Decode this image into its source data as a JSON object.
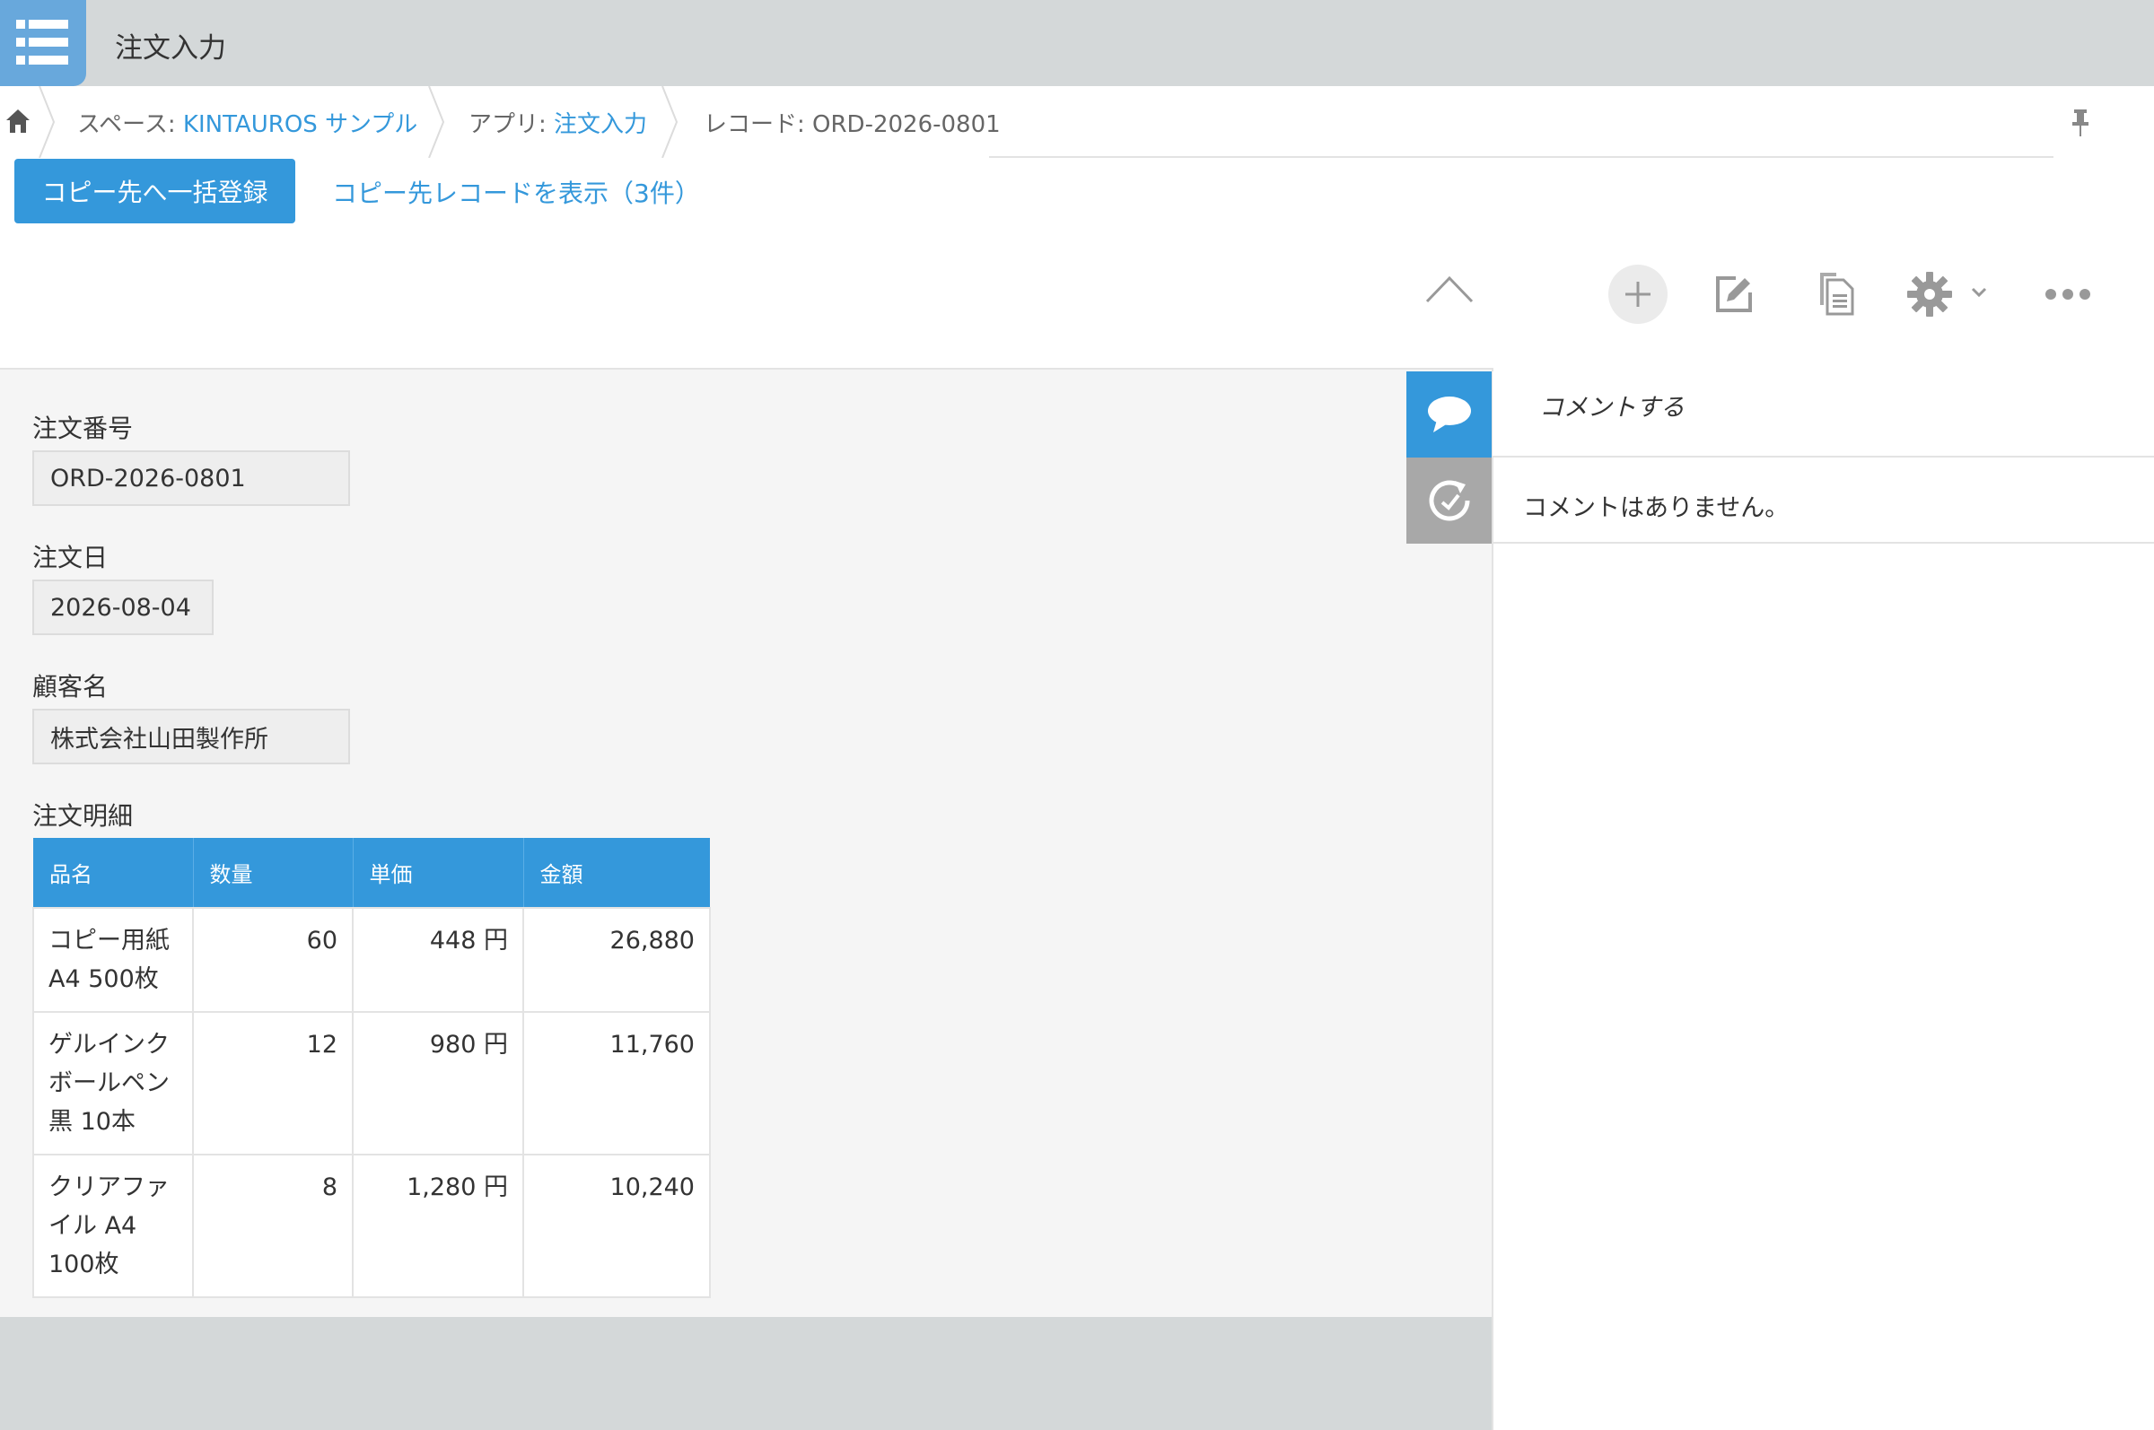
{
  "header": {
    "app_title": "注文入力"
  },
  "breadcrumb": {
    "space_prefix": "スペース: ",
    "space_name": "KINTAUROS サンプル",
    "app_prefix": "アプリ: ",
    "app_name": "注文入力",
    "record_label": "レコード: ORD-2026-0801"
  },
  "actions": {
    "bulk_register": "コピー先へ一括登録",
    "show_copies": "コピー先レコードを表示（3件）"
  },
  "fields": {
    "order_no_label": "注文番号",
    "order_no_value": "ORD-2026-0801",
    "order_date_label": "注文日",
    "order_date_value": "2026-08-04",
    "customer_label": "顧客名",
    "customer_value": "株式会社山田製作所",
    "detail_label": "注文明細"
  },
  "table": {
    "headers": [
      "品名",
      "数量",
      "単価",
      "金額"
    ],
    "rows": [
      {
        "name_l1": "コピー用紙",
        "name_l2": "A4 500枚",
        "name_l3": "",
        "qty": "60",
        "price": "448 円",
        "amount": "26,880"
      },
      {
        "name_l1": "ゲルインク",
        "name_l2": "ボールペン",
        "name_l3": "黒 10本",
        "qty": "12",
        "price": "980 円",
        "amount": "11,760"
      },
      {
        "name_l1": "クリアファ",
        "name_l2": "イル A4",
        "name_l3": "100枚",
        "qty": "8",
        "price": "1,280 円",
        "amount": "10,240"
      }
    ]
  },
  "comments": {
    "placeholder": "コメントする",
    "empty_text": "コメントはありません。"
  },
  "icons": {
    "app": "list-icon",
    "home": "home-icon",
    "pin": "pin-icon",
    "collapse": "chevron-up-icon",
    "add": "plus-icon",
    "edit": "edit-icon",
    "duplicate": "duplicate-icon",
    "settings": "gear-icon",
    "more": "more-icon",
    "comment_tab": "speech-bubble-icon",
    "history_tab": "history-icon"
  },
  "colors": {
    "accent": "#3498db",
    "header_bg": "#d4d8d9",
    "app_icon_bg": "#68a8dc",
    "history_tab_bg": "#a8a8a8"
  }
}
